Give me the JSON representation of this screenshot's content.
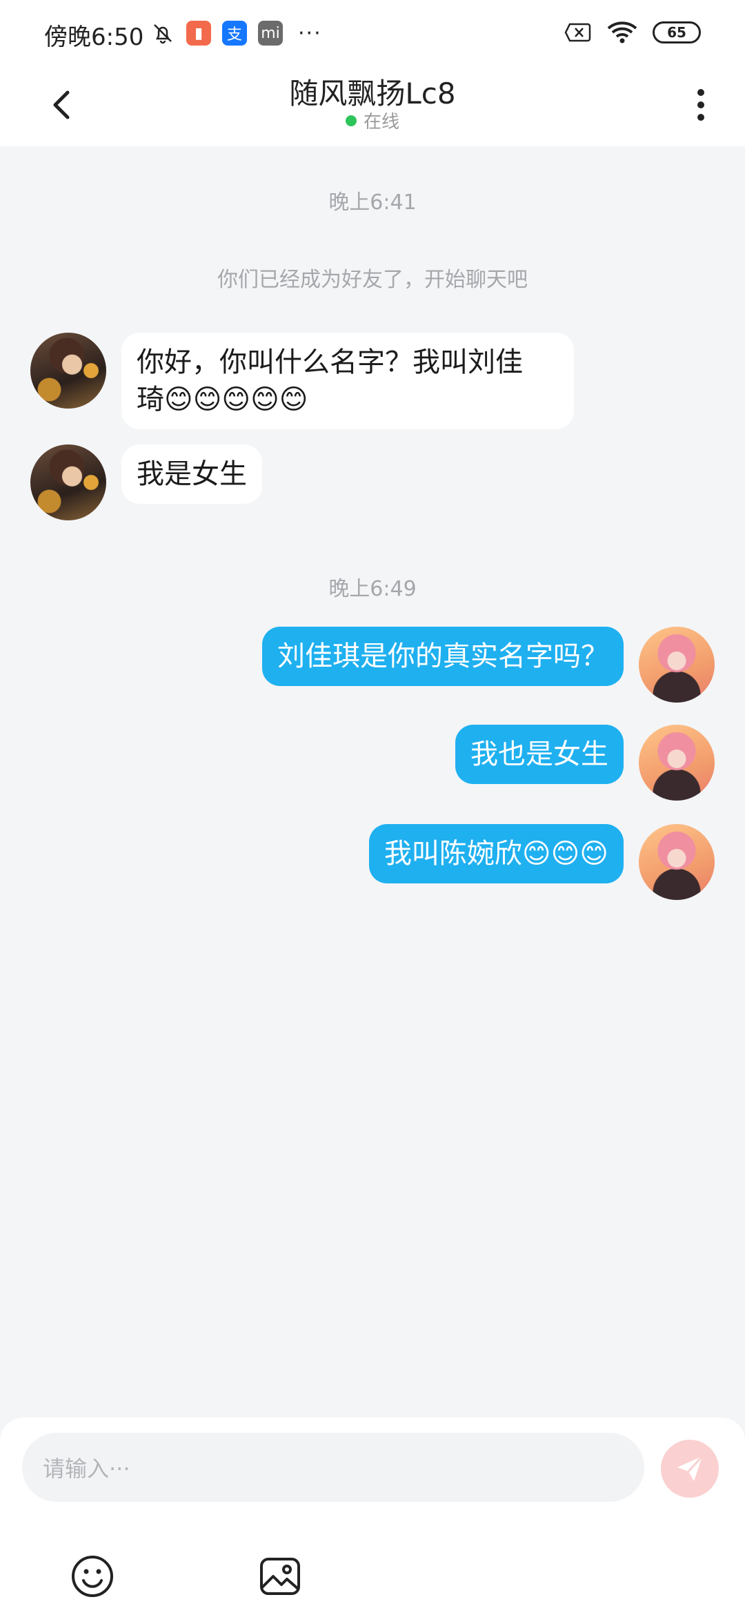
{
  "statusbar": {
    "time": "傍晚6:50",
    "icons": [
      "mute-bell-icon",
      "app-notification-icon",
      "alipay-icon",
      "mi-store-icon",
      "more-dots-icon",
      "sim-card-icon",
      "wifi-icon"
    ],
    "more": "···",
    "battery": "65"
  },
  "header": {
    "contact_name": "随风飘扬Lc8",
    "status": "在线"
  },
  "chat": {
    "timestamp_1": "晚上6:41",
    "system_message": "你们已经成为好友了，开始聊天吧",
    "incoming": [
      {
        "line1": "你好，你叫什么名字？我叫刘佳",
        "line2": "琦😊😊😊😊😊"
      },
      {
        "line1": "我是女生"
      }
    ],
    "timestamp_2": "晚上6:49",
    "outgoing": [
      {
        "text": "刘佳琪是你的真实名字吗？"
      },
      {
        "text": "我也是女生"
      },
      {
        "text": "我叫陈婉欣😊😊😊"
      }
    ]
  },
  "composer": {
    "placeholder": "请输入···",
    "tools": [
      "emoji-icon",
      "image-icon"
    ]
  },
  "colors": {
    "outgoing_bubble": "#1fb0f0",
    "incoming_bubble": "#ffffff",
    "online_dot": "#2ec55a",
    "send_button": "#fbd0d0"
  }
}
